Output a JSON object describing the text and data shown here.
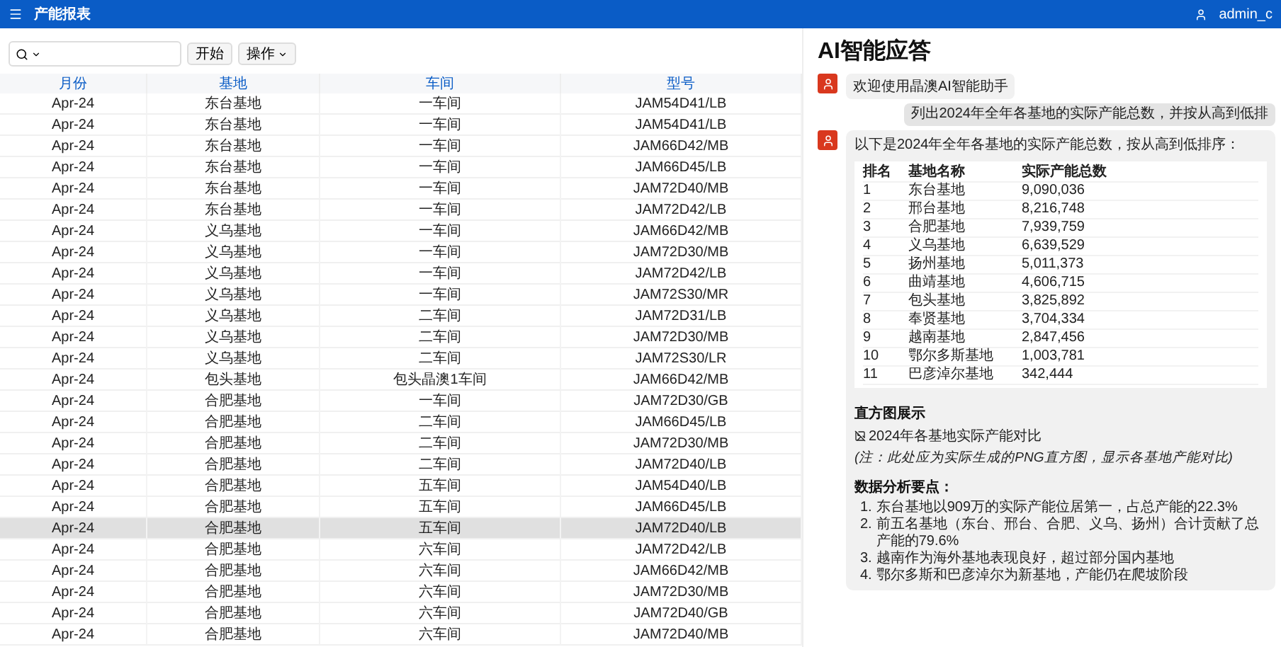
{
  "topbar": {
    "title": "产能报表",
    "user": "admin_c"
  },
  "toolbar": {
    "go_button": "开始",
    "actions_button": "操作"
  },
  "table": {
    "columns": [
      "月份",
      "基地",
      "车间",
      "型号"
    ],
    "rows": [
      {
        "cells": [
          "Apr-24",
          "东台基地",
          "一车间",
          "JAM54D41/LB"
        ],
        "selected": false
      },
      {
        "cells": [
          "Apr-24",
          "东台基地",
          "一车间",
          "JAM54D41/LB"
        ],
        "selected": false
      },
      {
        "cells": [
          "Apr-24",
          "东台基地",
          "一车间",
          "JAM66D42/MB"
        ],
        "selected": false
      },
      {
        "cells": [
          "Apr-24",
          "东台基地",
          "一车间",
          "JAM66D45/LB"
        ],
        "selected": false
      },
      {
        "cells": [
          "Apr-24",
          "东台基地",
          "一车间",
          "JAM72D40/MB"
        ],
        "selected": false
      },
      {
        "cells": [
          "Apr-24",
          "东台基地",
          "一车间",
          "JAM72D42/LB"
        ],
        "selected": false
      },
      {
        "cells": [
          "Apr-24",
          "义乌基地",
          "一车间",
          "JAM66D42/MB"
        ],
        "selected": false
      },
      {
        "cells": [
          "Apr-24",
          "义乌基地",
          "一车间",
          "JAM72D30/MB"
        ],
        "selected": false
      },
      {
        "cells": [
          "Apr-24",
          "义乌基地",
          "一车间",
          "JAM72D42/LB"
        ],
        "selected": false
      },
      {
        "cells": [
          "Apr-24",
          "义乌基地",
          "一车间",
          "JAM72S30/MR"
        ],
        "selected": false
      },
      {
        "cells": [
          "Apr-24",
          "义乌基地",
          "二车间",
          "JAM72D31/LB"
        ],
        "selected": false
      },
      {
        "cells": [
          "Apr-24",
          "义乌基地",
          "二车间",
          "JAM72D30/MB"
        ],
        "selected": false
      },
      {
        "cells": [
          "Apr-24",
          "义乌基地",
          "二车间",
          "JAM72S30/LR"
        ],
        "selected": false
      },
      {
        "cells": [
          "Apr-24",
          "包头基地",
          "包头晶澳1车间",
          "JAM66D42/MB"
        ],
        "selected": false
      },
      {
        "cells": [
          "Apr-24",
          "合肥基地",
          "一车间",
          "JAM72D30/GB"
        ],
        "selected": false
      },
      {
        "cells": [
          "Apr-24",
          "合肥基地",
          "二车间",
          "JAM66D45/LB"
        ],
        "selected": false
      },
      {
        "cells": [
          "Apr-24",
          "合肥基地",
          "二车间",
          "JAM72D30/MB"
        ],
        "selected": false
      },
      {
        "cells": [
          "Apr-24",
          "合肥基地",
          "二车间",
          "JAM72D40/LB"
        ],
        "selected": false
      },
      {
        "cells": [
          "Apr-24",
          "合肥基地",
          "五车间",
          "JAM54D40/LB"
        ],
        "selected": false
      },
      {
        "cells": [
          "Apr-24",
          "合肥基地",
          "五车间",
          "JAM66D45/LB"
        ],
        "selected": false
      },
      {
        "cells": [
          "Apr-24",
          "合肥基地",
          "五车间",
          "JAM72D40/LB"
        ],
        "selected": true
      },
      {
        "cells": [
          "Apr-24",
          "合肥基地",
          "六车间",
          "JAM72D42/LB"
        ],
        "selected": false
      },
      {
        "cells": [
          "Apr-24",
          "合肥基地",
          "六车间",
          "JAM66D42/MB"
        ],
        "selected": false
      },
      {
        "cells": [
          "Apr-24",
          "合肥基地",
          "六车间",
          "JAM72D30/MB"
        ],
        "selected": false
      },
      {
        "cells": [
          "Apr-24",
          "合肥基地",
          "六车间",
          "JAM72D40/GB"
        ],
        "selected": false
      },
      {
        "cells": [
          "Apr-24",
          "合肥基地",
          "六车间",
          "JAM72D40/MB"
        ],
        "selected": false
      }
    ]
  },
  "assistant": {
    "title": "AI智能应答",
    "greeting": "欢迎使用晶澳AI智能助手",
    "question": "列出2024年全年各基地的实际产能总数，并按从高到低排",
    "answer_intro": "以下是2024年全年各基地的实际产能总数，按从高到低排序：",
    "ranking": {
      "columns": [
        "排名",
        "基地名称",
        "实际产能总数"
      ],
      "rows": [
        [
          "1",
          "东台基地",
          "9,090,036"
        ],
        [
          "2",
          "邢台基地",
          "8,216,748"
        ],
        [
          "3",
          "合肥基地",
          "7,939,759"
        ],
        [
          "4",
          "义乌基地",
          "6,639,529"
        ],
        [
          "5",
          "扬州基地",
          "5,011,373"
        ],
        [
          "6",
          "曲靖基地",
          "4,606,715"
        ],
        [
          "7",
          "包头基地",
          "3,825,892"
        ],
        [
          "8",
          "奉贤基地",
          "3,704,334"
        ],
        [
          "9",
          "越南基地",
          "2,847,456"
        ],
        [
          "10",
          "鄂尔多斯基地",
          "1,003,781"
        ],
        [
          "11",
          "巴彦淖尔基地",
          "342,444"
        ]
      ]
    },
    "chart_heading": "直方图展示",
    "chart_alt": "2024年各基地实际产能对比",
    "note": "(注：此处应为实际生成的PNG直方图，显示各基地产能对比)",
    "analysis_heading": "数据分析要点：",
    "points": [
      {
        "marker": "1.",
        "text": "东台基地以909万的实际产能位居第一，占总产能的22.3%"
      },
      {
        "marker": "2.",
        "text": "前五名基地（东台、邢台、合肥、义乌、扬州）合计贡献了总产能的79.6%"
      },
      {
        "marker": "3.",
        "text": "越南作为海外基地表现良好，超过部分国内基地"
      },
      {
        "marker": "4.",
        "text": "鄂尔多斯和巴彦淖尔为新基地，产能仍在爬坡阶段"
      }
    ]
  }
}
